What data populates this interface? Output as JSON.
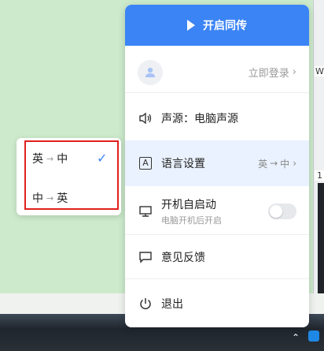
{
  "panel": {
    "start_label": "开启同传",
    "login_label": "立即登录",
    "source_label": "声源：电脑声源",
    "language_label": "语言设置",
    "language_value_from": "英",
    "language_value_to": "中",
    "boot_label": "开机自启动",
    "boot_sub": "电脑开机后开启",
    "boot_enabled": false,
    "feedback_label": "意见反馈",
    "exit_label": "退出"
  },
  "language_popup": {
    "options": [
      {
        "from": "英",
        "to": "中",
        "selected": true
      },
      {
        "from": "中",
        "to": "英",
        "selected": false
      }
    ]
  },
  "side_window": {
    "fragment_1": "W",
    "fragment_2": "1"
  },
  "colors": {
    "accent": "#3b84f5",
    "highlight_frame": "#e0201e",
    "selected_row_bg": "#eaf2ff"
  }
}
